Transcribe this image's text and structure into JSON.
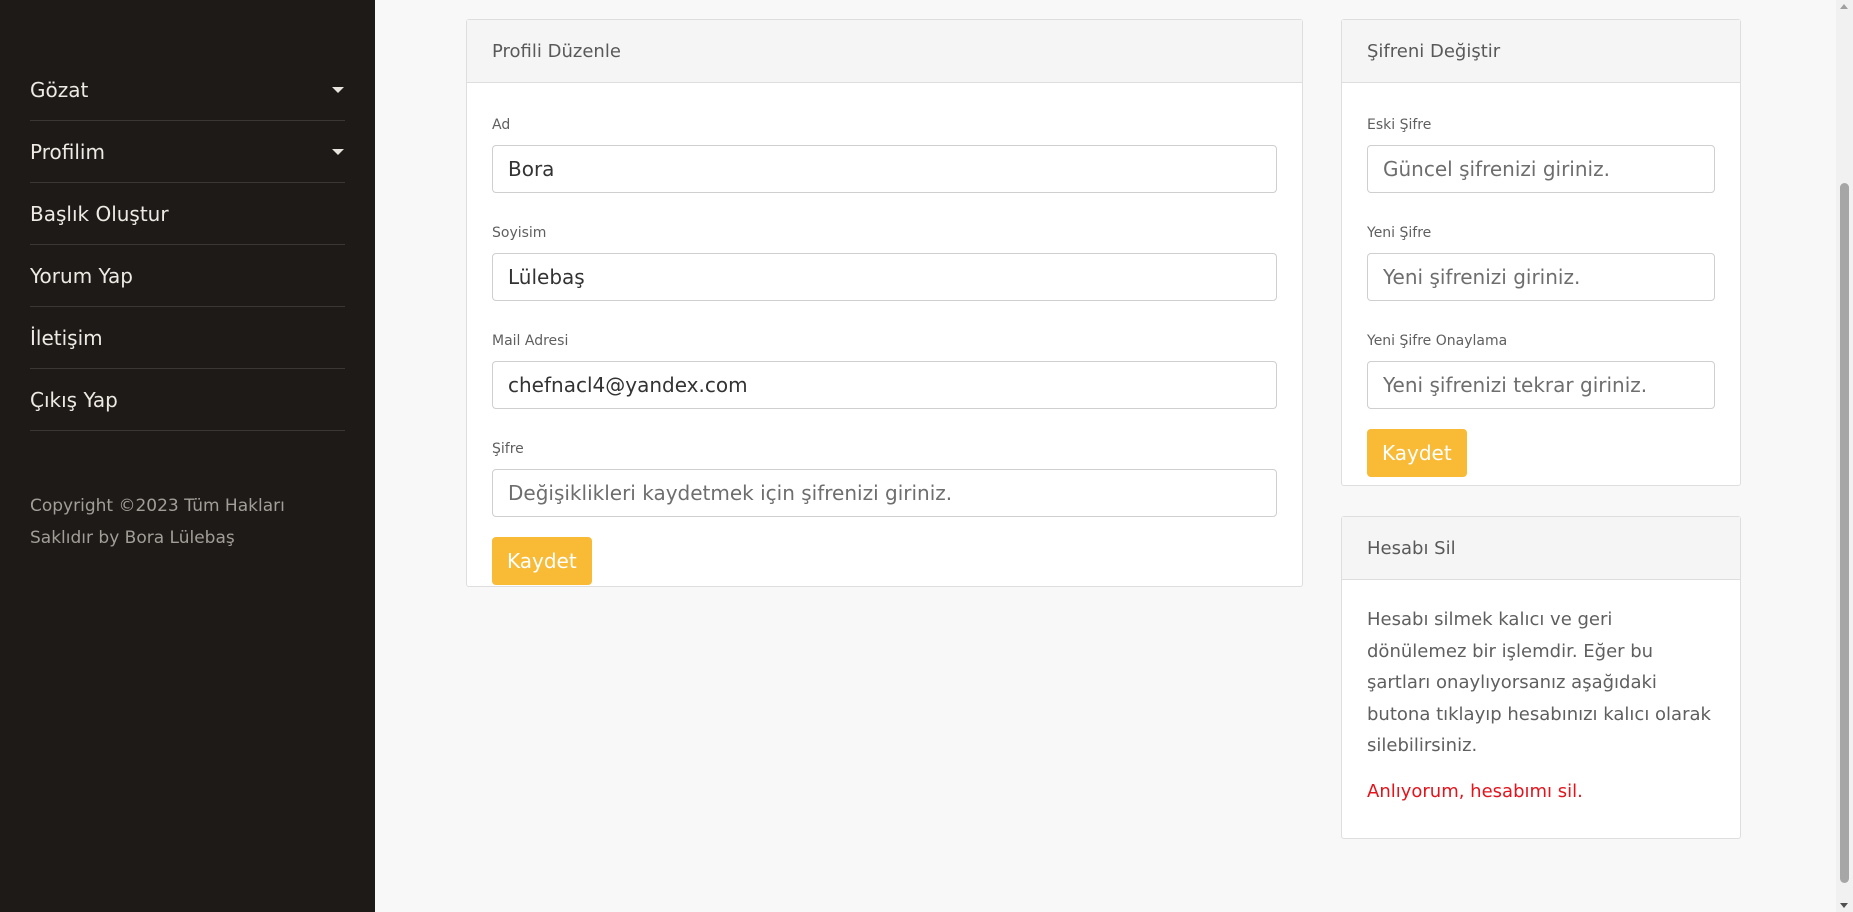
{
  "sidebar": {
    "items": [
      {
        "label": "Gözat",
        "has_dropdown": true
      },
      {
        "label": "Profilim",
        "has_dropdown": true
      },
      {
        "label": "Başlık Oluştur"
      },
      {
        "label": "Yorum Yap"
      },
      {
        "label": "İletişim"
      },
      {
        "label": "Çıkış Yap"
      }
    ],
    "copyright": "Copyright ©2023 Tüm Hakları Saklıdır by Bora Lülebaş"
  },
  "profile_card": {
    "title": "Profili Düzenle",
    "fields": {
      "name": {
        "label": "Ad",
        "value": "Bora"
      },
      "surname": {
        "label": "Soyisim",
        "value": "Lülebaş"
      },
      "email": {
        "label": "Mail Adresi",
        "value": "chefnacl4@yandex.com"
      },
      "password": {
        "label": "Şifre",
        "placeholder": "Değişiklikleri kaydetmek için şifrenizi giriniz."
      }
    },
    "save_label": "Kaydet"
  },
  "password_card": {
    "title": "Şifreni Değiştir",
    "fields": {
      "old": {
        "label": "Eski Şifre",
        "placeholder": "Güncel şifrenizi giriniz."
      },
      "new": {
        "label": "Yeni Şifre",
        "placeholder": "Yeni şifrenizi giriniz."
      },
      "confirm": {
        "label": "Yeni Şifre Onaylama",
        "placeholder": "Yeni şifrenizi tekrar giriniz."
      }
    },
    "save_label": "Kaydet"
  },
  "delete_card": {
    "title": "Hesabı Sil",
    "description": "Hesabı silmek kalıcı ve geri dönülemez bir işlemdir. Eğer bu şartları onaylıyorsanız aşağıdaki butona tıklayıp hesabınızı kalıcı olarak silebilirsiniz.",
    "link_label": "Anlıyorum, hesabımı sil."
  },
  "colors": {
    "sidebar_bg": "#1d1a18",
    "accent": "#f9ba36",
    "danger": "#e3131b"
  }
}
